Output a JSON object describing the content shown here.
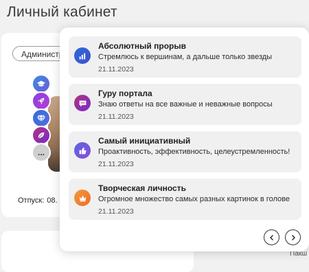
{
  "page": {
    "title": "Личный кабинет"
  },
  "profile": {
    "role_chip": "Администр",
    "vacation_label": "Отпуск:",
    "vacation_value": "08.",
    "badges": [
      {
        "icon": "graduation-cap-icon"
      },
      {
        "icon": "rocket-icon"
      },
      {
        "icon": "diamond-icon"
      },
      {
        "icon": "leaf-icon"
      },
      {
        "icon": "more-icon",
        "label": "..."
      }
    ]
  },
  "right_peek_text": "Пакш",
  "achievements": [
    {
      "icon": "bar-chart-icon",
      "title": "Абсолютный прорыв",
      "description": "Стремлюсь к вершинам, а дальше только звезды",
      "date": "21.11.2023",
      "color": "#2d6bd6"
    },
    {
      "icon": "chat-icon",
      "title": "Гуру портала",
      "description": "Знаю ответы на все важные и неважные вопросы",
      "date": "21.11.2023",
      "color": "#a8357e"
    },
    {
      "icon": "thumbs-up-icon",
      "title": "Самый инициативный",
      "description": "Проактивность, эффективность, целеустремленность!",
      "date": "21.11.2023",
      "color": "#6a5ae0"
    },
    {
      "icon": "crown-icon",
      "title": "Творческая личность",
      "description": "Огромное множество самых разных картинок в голове",
      "date": "21.11.2023",
      "color": "#f08a32"
    }
  ],
  "pager": {
    "prev_icon": "chevron-left-icon",
    "next_icon": "chevron-right-icon"
  }
}
